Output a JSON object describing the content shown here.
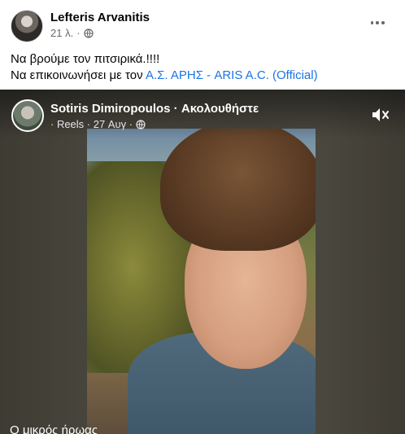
{
  "post": {
    "author": "Lefteris Arvanitis",
    "time": "21 λ.",
    "dot": "·",
    "text_line1": "Να βρούμε τον πιτσιρικά.!!!!",
    "text_line2_prefix": "Να επικοινωνήσει με τον ",
    "mention": "Α.Σ. ΑΡΗΣ - ARIS A.C. (Official)"
  },
  "video": {
    "author": "Sotiris Dimiropoulos",
    "separator": " · ",
    "follow": "Ακολουθήστε",
    "meta": "· Reels · 27 Αυγ ·",
    "caption": "Ο μικρός ήρωας"
  },
  "icons": {
    "privacy": "globe-icon",
    "more": "more-options-icon",
    "mute": "muted-speaker-icon",
    "audience": "public-icon"
  },
  "colors": {
    "link": "#1b74e4",
    "muted_text": "#65676b"
  }
}
